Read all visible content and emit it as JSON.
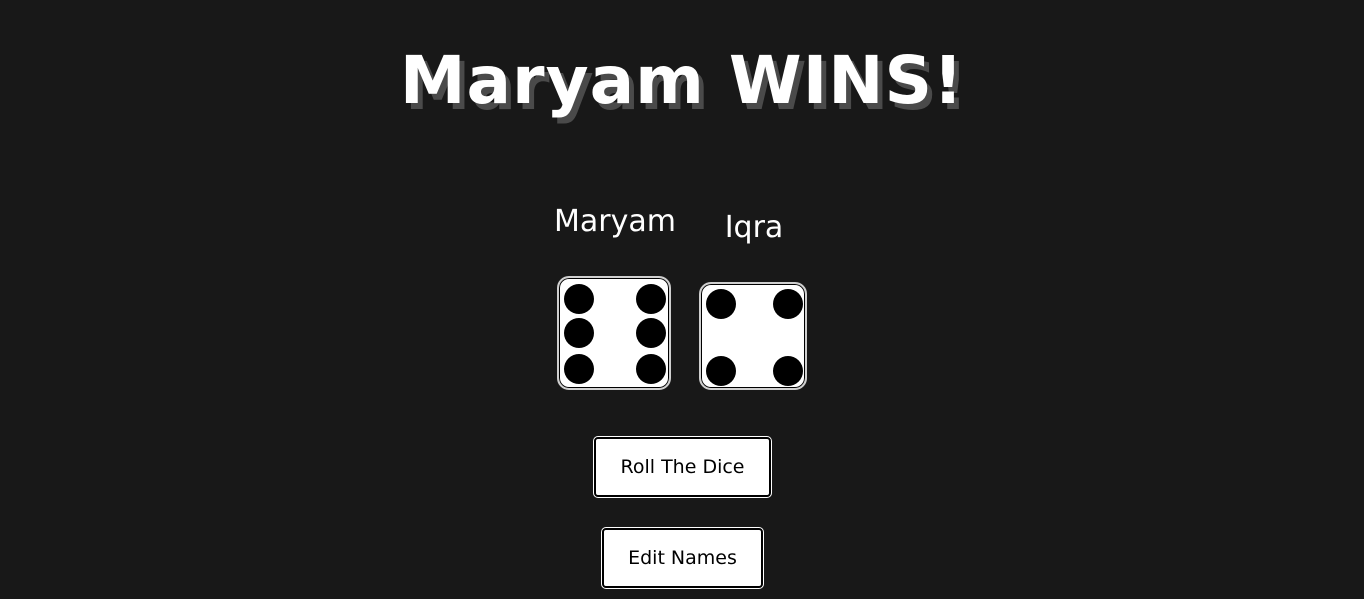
{
  "header": {
    "title": "Maryam WINS!"
  },
  "players": [
    {
      "name": "Maryam",
      "die_value": 6
    },
    {
      "name": "Iqra",
      "die_value": 4
    }
  ],
  "controls": {
    "roll_label": "Roll The Dice",
    "edit_label": "Edit Names"
  },
  "colors": {
    "background": "#181818",
    "text": "#ffffff",
    "title_shadow": "#4a4a4a",
    "die_face": "#ffffff",
    "pip": "#000000"
  }
}
